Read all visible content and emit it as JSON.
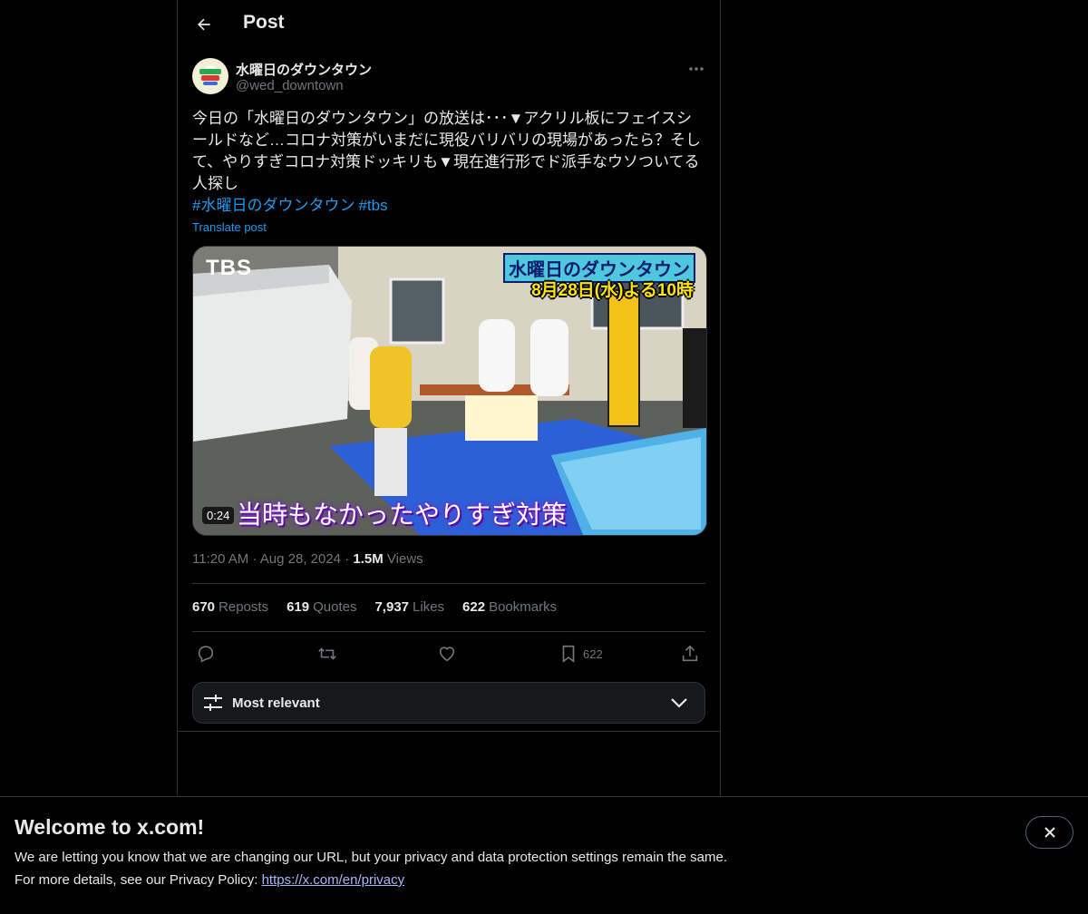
{
  "header": {
    "title": "Post"
  },
  "post": {
    "display_name": "水曜日のダウンタウン",
    "handle": "@wed_downtown",
    "text": "今日の「水曜日のダウンタウン」の放送は･･･▼アクリル板にフェイスシールドなど…コロナ対策がいまだに現役バリバリの現場があったら？そして、やりすぎコロナ対策ドッキリも▼現在進行形でド派手なウソついてる人探し",
    "hashtags": [
      "#水曜日のダウンタウン",
      "#tbs"
    ],
    "translate_label": "Translate post",
    "media": {
      "duration": "0:24",
      "corner_logo": "TBS",
      "show_title": "水曜日のダウンタウン",
      "show_date": "8月28日(水)よる10時",
      "caption": "当時もなかったやりすぎ対策"
    },
    "time": "11:20 AM",
    "date": "Aug 28, 2024",
    "views_count": "1.5M",
    "views_label": "Views",
    "stats": {
      "reposts_count": "670",
      "reposts_label": "Reposts",
      "quotes_count": "619",
      "quotes_label": "Quotes",
      "likes_count": "7,937",
      "likes_label": "Likes",
      "bookmarks_count": "622",
      "bookmarks_label": "Bookmarks"
    },
    "actions": {
      "bookmark_count": "622"
    },
    "icons": [
      "back-arrow-icon",
      "more-icon",
      "reply-icon",
      "repost-icon",
      "like-icon",
      "bookmark-icon",
      "share-icon",
      "sliders-icon",
      "chevron-down-icon",
      "close-icon"
    ]
  },
  "sort": {
    "label": "Most relevant"
  },
  "banner": {
    "title": "Welcome to x.com!",
    "line1": "We are letting you know that we are changing our URL, but your privacy and data protection settings remain the same.",
    "line2_prefix": "For more details, see our Privacy Policy: ",
    "link": "https://x.com/en/privacy"
  },
  "colors": {
    "accent": "#1d9bf0",
    "muted": "#71767b",
    "border": "#2f3336"
  }
}
